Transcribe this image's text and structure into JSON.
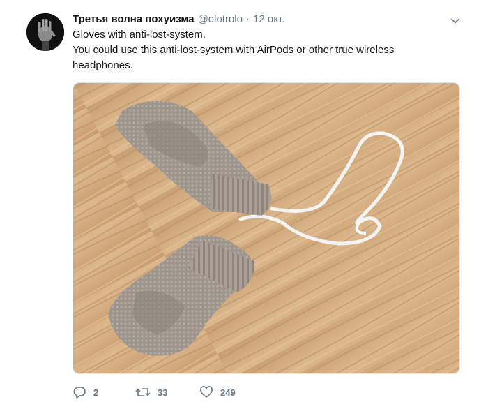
{
  "tweet": {
    "display_name": "Третья волна похуизма",
    "handle": "@olotrolo",
    "separator": "·",
    "timestamp": "12 окт.",
    "text_line1": "Gloves with anti-lost-system.",
    "text_line2": "You could use this anti-lost-system with AirPods or other true wireless headphones."
  },
  "media": {
    "subject": "two knitted grey mittens connected by a white elastic cord on a wooden floor"
  },
  "actions": {
    "reply_count": "2",
    "retweet_count": "33",
    "like_count": "249"
  },
  "icons": {
    "caret": "chevron-down-icon",
    "reply": "reply-icon",
    "retweet": "retweet-icon",
    "like": "heart-icon"
  },
  "colors": {
    "text": "#14171a",
    "secondary": "#657786",
    "border": "#e1e8ed"
  }
}
